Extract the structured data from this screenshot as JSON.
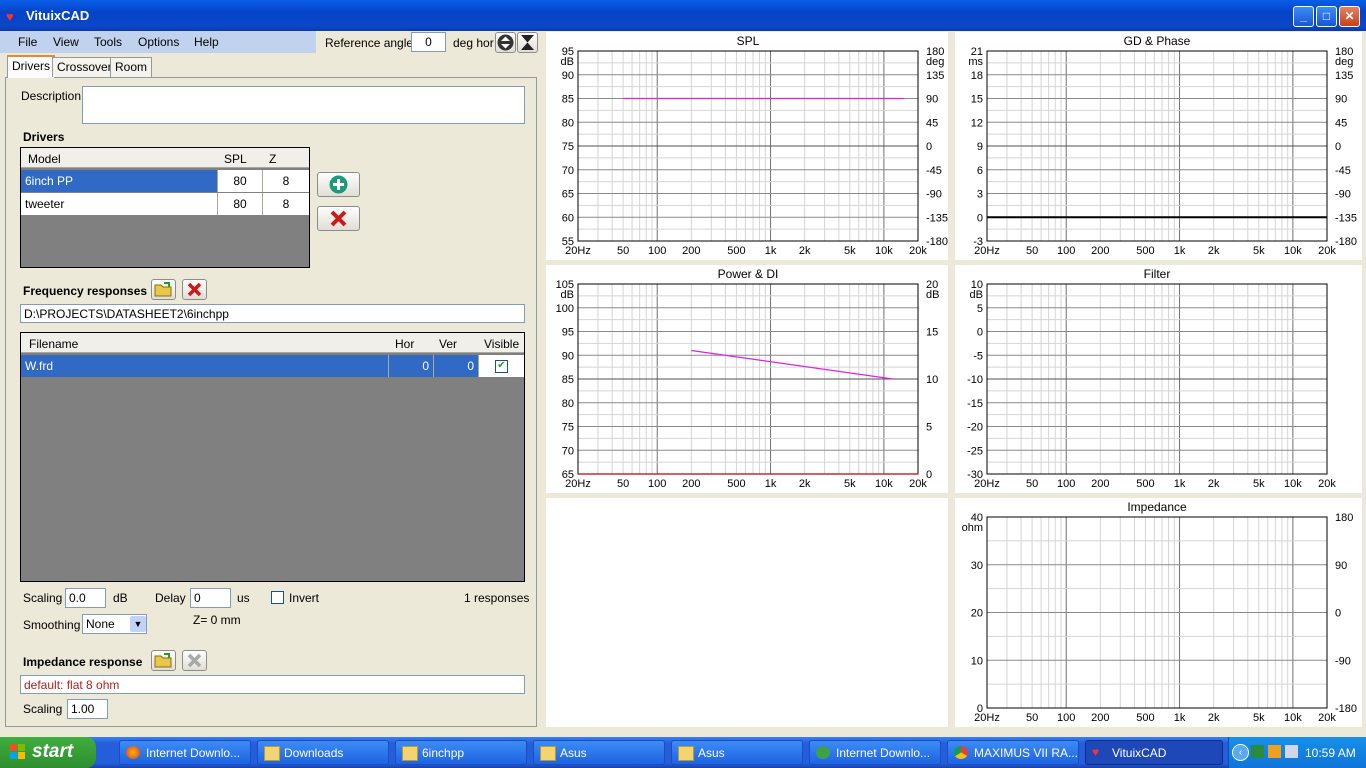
{
  "window": {
    "title": "VituixCAD"
  },
  "menu": {
    "items": [
      "File",
      "View",
      "Tools",
      "Options",
      "Help"
    ]
  },
  "reference": {
    "label": "Reference angle",
    "value": "0",
    "unit": "deg hor"
  },
  "tabs": [
    "Drivers",
    "Crossover",
    "Room"
  ],
  "description": {
    "label": "Description",
    "value": ""
  },
  "drivers": {
    "heading": "Drivers",
    "columns": [
      "Model",
      "SPL",
      "Z"
    ],
    "rows": [
      {
        "model": "6inch PP",
        "spl": "80",
        "z": "8"
      },
      {
        "model": "tweeter",
        "spl": "80",
        "z": "8"
      }
    ]
  },
  "frequency": {
    "heading": "Frequency responses",
    "path": "D:\\PROJECTS\\DATASHEET2\\6inchpp",
    "columns": [
      "Filename",
      "Hor",
      "Ver",
      "Visible"
    ],
    "rows": [
      {
        "filename": "W.frd",
        "hor": "0",
        "ver": "0",
        "visible": "✔"
      }
    ],
    "scaling_label": "Scaling",
    "scaling_value": "0.0",
    "scaling_unit": "dB",
    "delay_label": "Delay",
    "delay_value": "0",
    "delay_unit": "us",
    "invert_label": "Invert",
    "count": "1 responses",
    "smoothing_label": "Smoothing",
    "smoothing_value": "None",
    "z_offset": "Z= 0 mm"
  },
  "impedance": {
    "heading": "Impedance response",
    "value": "default: flat 8 ohm",
    "scaling_label": "Scaling",
    "scaling_value": "1.00"
  },
  "chart_data": [
    {
      "type": "line",
      "title": "SPL",
      "x_scale": "log",
      "xlim": [
        20,
        20000
      ],
      "x_ticks": [
        "20Hz",
        "50",
        "100",
        "200",
        "500",
        "1k",
        "2k",
        "5k",
        "10k",
        "20k"
      ],
      "y_unit": "dB",
      "ylim": [
        55,
        95
      ],
      "y_ticks": [
        "95",
        "90",
        "85",
        "80",
        "75",
        "70",
        "65",
        "60",
        "55"
      ],
      "y2_unit": "deg",
      "y2lim": [
        -180,
        180
      ],
      "y2_ticks": [
        "180",
        "135",
        "90",
        "45",
        "0",
        "-45",
        "-90",
        "-135",
        "-180"
      ],
      "series": [
        {
          "color": "#e020e0",
          "x": [
            50,
            15000
          ],
          "y": [
            85,
            85
          ]
        }
      ]
    },
    {
      "type": "line",
      "title": "GD & Phase",
      "x_scale": "log",
      "xlim": [
        20,
        20000
      ],
      "x_ticks": [
        "20Hz",
        "50",
        "100",
        "200",
        "500",
        "1k",
        "2k",
        "5k",
        "10k",
        "20k"
      ],
      "y_unit": "ms",
      "ylim": [
        -3,
        21
      ],
      "y_ticks": [
        "21",
        "18",
        "15",
        "12",
        "9",
        "6",
        "3",
        "0",
        "-3"
      ],
      "y2_unit": "deg",
      "y2lim": [
        -180,
        180
      ],
      "y2_ticks": [
        "180",
        "135",
        "90",
        "45",
        "0",
        "-45",
        "-90",
        "-135",
        "-180"
      ],
      "series": [
        {
          "color": "#000000",
          "x": [
            20,
            20000
          ],
          "y": [
            0,
            0
          ]
        }
      ]
    },
    {
      "type": "line",
      "title": "Power & DI",
      "x_scale": "log",
      "xlim": [
        20,
        20000
      ],
      "x_ticks": [
        "20Hz",
        "50",
        "100",
        "200",
        "500",
        "1k",
        "2k",
        "5k",
        "10k",
        "20k"
      ],
      "y_unit": "dB",
      "ylim": [
        65,
        105
      ],
      "y_ticks": [
        "105",
        "100",
        "95",
        "90",
        "85",
        "80",
        "75",
        "70",
        "65"
      ],
      "y2_unit": "dB",
      "y2lim": [
        0,
        20
      ],
      "y2_ticks": [
        "20",
        "15",
        "10",
        "5",
        "0"
      ],
      "series": [
        {
          "color": "#e020e0",
          "x": [
            200,
            12000
          ],
          "y": [
            91,
            85
          ]
        },
        {
          "color": "#c00000",
          "x": [
            20,
            20000
          ],
          "y": [
            65,
            65
          ]
        }
      ]
    },
    {
      "type": "line",
      "title": "Filter",
      "x_scale": "log",
      "xlim": [
        20,
        20000
      ],
      "x_ticks": [
        "20Hz",
        "50",
        "100",
        "200",
        "500",
        "1k",
        "2k",
        "5k",
        "10k",
        "20k"
      ],
      "y_unit": "dB",
      "ylim": [
        -30,
        10
      ],
      "y_ticks": [
        "10",
        "5",
        "0",
        "-5",
        "-10",
        "-15",
        "-20",
        "-25",
        "-30"
      ],
      "y2_ticks": [],
      "series": []
    },
    {
      "type": "line",
      "title": "Impedance",
      "x_scale": "log",
      "xlim": [
        20,
        20000
      ],
      "x_ticks": [
        "20Hz",
        "50",
        "100",
        "200",
        "500",
        "1k",
        "2k",
        "5k",
        "10k",
        "20k"
      ],
      "y_unit": "ohm",
      "ylim": [
        0,
        40
      ],
      "y_ticks": [
        "40",
        "30",
        "20",
        "10",
        "0"
      ],
      "y2_unit": "",
      "y2lim": [
        -180,
        180
      ],
      "y2_ticks": [
        "180",
        "90",
        "0",
        "-90",
        "-180"
      ],
      "series": []
    }
  ],
  "taskbar": {
    "start": "start",
    "tasks": [
      "Internet Downlo...",
      "Downloads",
      "6inchpp",
      "Asus",
      "Asus",
      "Internet Downlo...",
      "MAXIMUS VII RA...",
      "VituixCAD"
    ],
    "clock": "10:59 AM"
  }
}
